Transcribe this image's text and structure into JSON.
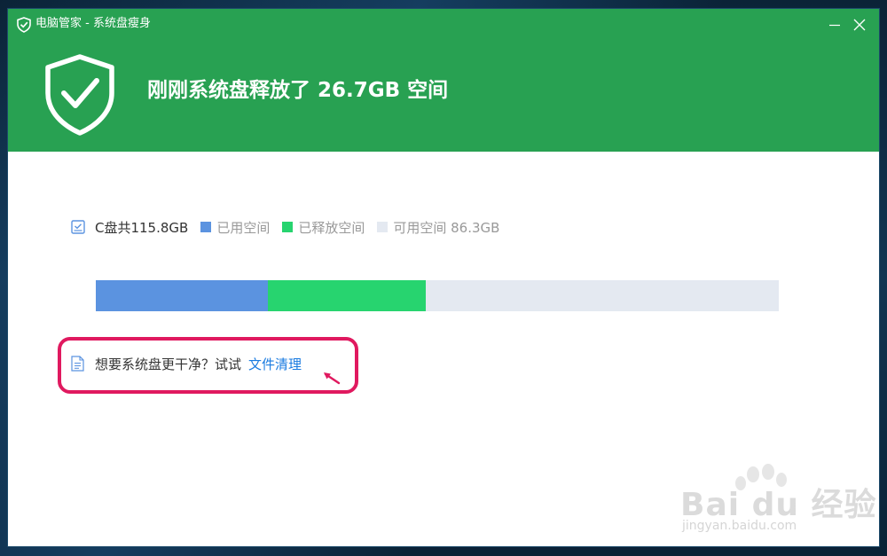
{
  "window": {
    "title": "电脑管家 - 系统盘瘦身"
  },
  "header": {
    "headline": "刚刚系统盘释放了 26.7GB 空间"
  },
  "legend": {
    "total": "C盘共115.8GB",
    "used_label": "已用空间",
    "freed_label": "已释放空间",
    "free_label": "可用空间 86.3GB"
  },
  "usage": {
    "used_fraction": 0.252,
    "freed_fraction": 0.231,
    "colors": {
      "used": "#5b93e0",
      "freed": "#27d46f",
      "free": "#e4e9f1",
      "header": "#28a152",
      "link": "#1a7be0",
      "annotation": "#e0195f"
    }
  },
  "tip": {
    "text": "想要系统盘更干净？试试",
    "link": "文件清理"
  },
  "watermark": {
    "brand": "Bai du 经验",
    "url": "jingyan.baidu.com"
  },
  "icons": {
    "app_logo": "shield-logo-icon",
    "minimize": "minimize-icon",
    "close": "close-icon",
    "hero": "shield-check-icon",
    "legend_check": "disk-check-icon",
    "tip": "document-icon",
    "pointer": "arrow-pointer-icon"
  }
}
